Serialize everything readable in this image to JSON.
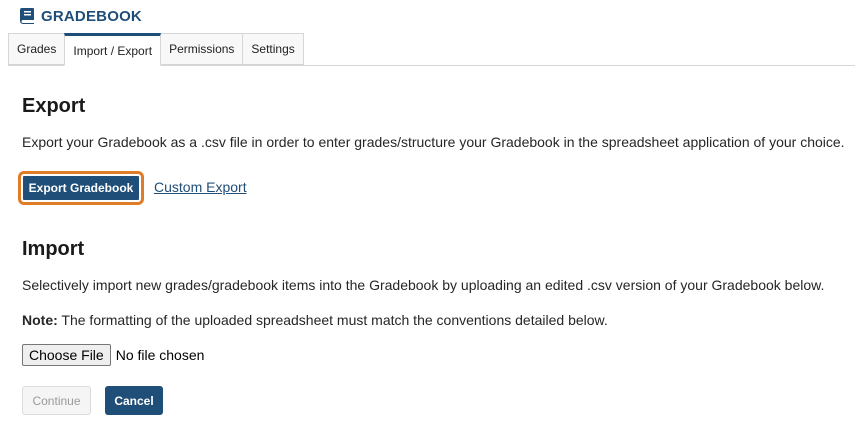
{
  "header": {
    "title": "GRADEBOOK",
    "icon": "book-icon"
  },
  "tabs": [
    {
      "label": "Grades",
      "active": false
    },
    {
      "label": "Import / Export",
      "active": true
    },
    {
      "label": "Permissions",
      "active": false
    },
    {
      "label": "Settings",
      "active": false
    }
  ],
  "export": {
    "heading": "Export",
    "description": "Export your Gradebook as a .csv file in order to enter grades/structure your Gradebook in the spreadsheet application of your choice.",
    "button_label": "Export Gradebook",
    "custom_link": "Custom Export"
  },
  "import": {
    "heading": "Import",
    "description": "Selectively import new grades/gradebook items into the Gradebook by uploading an edited .csv version of your Gradebook below.",
    "note_label": "Note:",
    "note_text": " The formatting of the uploaded spreadsheet must match the conventions detailed below.",
    "file_button": "Choose File",
    "file_status": "No file chosen",
    "continue_label": "Continue",
    "cancel_label": "Cancel"
  },
  "colors": {
    "primary": "#1f4e79",
    "focus_ring": "#e07b28"
  }
}
